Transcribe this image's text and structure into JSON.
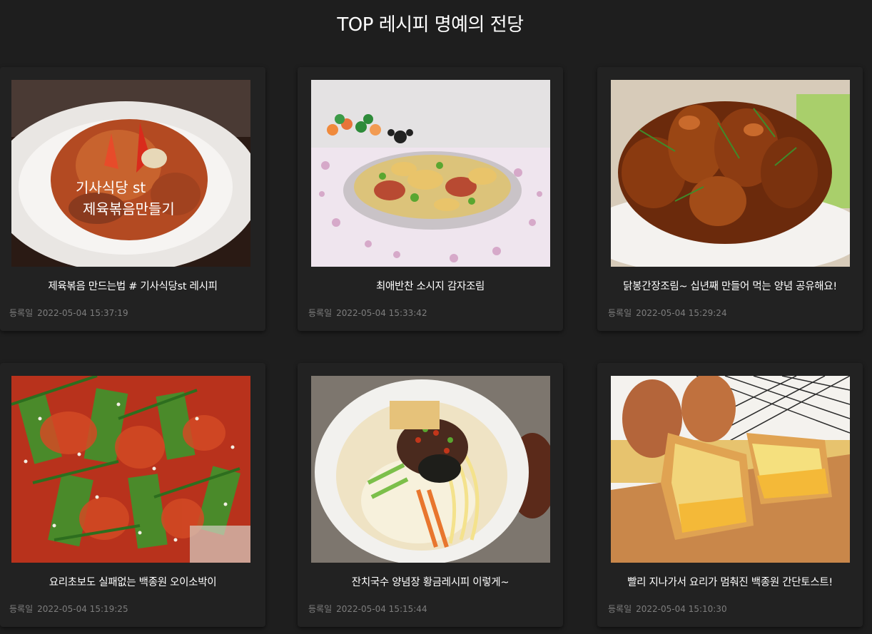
{
  "page": {
    "title": "TOP 레시피 명예의 전당"
  },
  "cards": [
    {
      "title": "제육볶음 만드는법 # 기사식당st 레시피",
      "date_label": "등록일",
      "date": "2022-05-04 15:37:19",
      "image_caption_line1": "기사식당 st",
      "image_caption_line2": "제육볶음만들기"
    },
    {
      "title": "최애반찬 소시지 감자조림",
      "date_label": "등록일",
      "date": "2022-05-04 15:33:42"
    },
    {
      "title": "닭봉간장조림~ 십년째 만들어 먹는 양념 공유해요!",
      "date_label": "등록일",
      "date": "2022-05-04 15:29:24"
    },
    {
      "title": "요리초보도 실패없는 백종원 오이소박이",
      "date_label": "등록일",
      "date": "2022-05-04 15:19:25"
    },
    {
      "title": "잔치국수 양념장 황금레시피 이렇게~",
      "date_label": "등록일",
      "date": "2022-05-04 15:15:44"
    },
    {
      "title": "빨리 지나가서 요리가 멈춰진 백종원 간단토스트!",
      "date_label": "등록일",
      "date": "2022-05-04 15:10:30"
    }
  ],
  "colors": {
    "background": "#1e1e1e",
    "card": "#222222",
    "meta_text": "#7d7d7d",
    "title_text": "#ffffff"
  }
}
